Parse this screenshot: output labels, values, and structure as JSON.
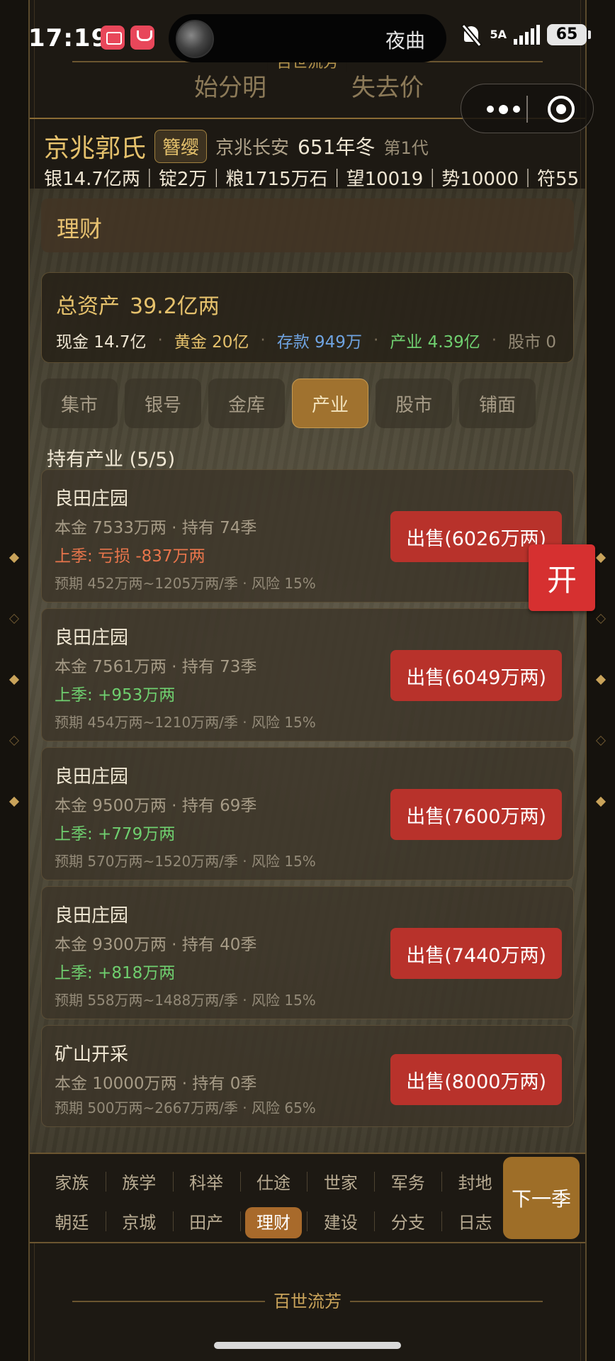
{
  "status": {
    "time": "17:19",
    "island_text": "夜曲",
    "network": "5A",
    "battery": "65"
  },
  "game": {
    "top_title": "百世流芳",
    "top_left_text": "始分明",
    "top_right_text": "失去价"
  },
  "family": {
    "name": "京兆郭氏",
    "rank_badge": "簪缨",
    "location": "京兆长安",
    "year": "651年冬",
    "generation": "第1代",
    "resources": "银14.7亿两｜锭2万｜粮1715万石｜望10019｜势10000｜符55"
  },
  "panel": {
    "title": "理财",
    "total_label": "总资产",
    "total_value": "39.2亿两",
    "breakdown": [
      {
        "label": "现金 14.7亿",
        "color": "#efe6d3"
      },
      {
        "label": "黄金 20亿",
        "color": "#e5c16c"
      },
      {
        "label": "存款 949万",
        "color": "#6fa3e0"
      },
      {
        "label": "产业 4.39亿",
        "color": "#6fcf6f"
      },
      {
        "label": "股市 0",
        "color": "#948a76"
      }
    ]
  },
  "tabs": [
    "集市",
    "银号",
    "金库",
    "产业",
    "股市",
    "铺面"
  ],
  "active_tab": "产业",
  "holdings": {
    "title": "持有产业 (5/5)",
    "items": [
      {
        "name": "良田庄园",
        "info": "本金 7533万两 · 持有 74季",
        "last": "上季: 亏损 -837万两",
        "last_type": "loss",
        "expect": "预期 452万两~1205万两/季 · 风险 15%",
        "sell": "出售(6026万两)"
      },
      {
        "name": "良田庄园",
        "info": "本金 7561万两 · 持有 73季",
        "last": "上季: +953万两",
        "last_type": "gain",
        "expect": "预期 454万两~1210万两/季 · 风险 15%",
        "sell": "出售(6049万两)"
      },
      {
        "name": "良田庄园",
        "info": "本金 9500万两 · 持有 69季",
        "last": "上季: +779万两",
        "last_type": "gain",
        "expect": "预期 570万两~1520万两/季 · 风险 15%",
        "sell": "出售(7600万两)"
      },
      {
        "name": "良田庄园",
        "info": "本金 9300万两 · 持有 40季",
        "last": "上季: +818万两",
        "last_type": "gain",
        "expect": "预期 558万两~1488万两/季 · 风险 15%",
        "sell": "出售(7440万两)"
      },
      {
        "name": "矿山开采",
        "info": "本金 10000万两 · 持有 0季",
        "last": "",
        "last_type": "none",
        "expect": "预期 500万两~2667万两/季 · 风险 65%",
        "sell": "出售(8000万两)"
      }
    ]
  },
  "open_button": "开",
  "nav": {
    "row1": [
      "家族",
      "族学",
      "科举",
      "仕途",
      "世家",
      "军务",
      "封地"
    ],
    "row2": [
      "朝廷",
      "京城",
      "田产",
      "理财",
      "建设",
      "分支",
      "日志"
    ],
    "active": "理财",
    "next_label": "下一季"
  },
  "footer_title": "百世流芳"
}
